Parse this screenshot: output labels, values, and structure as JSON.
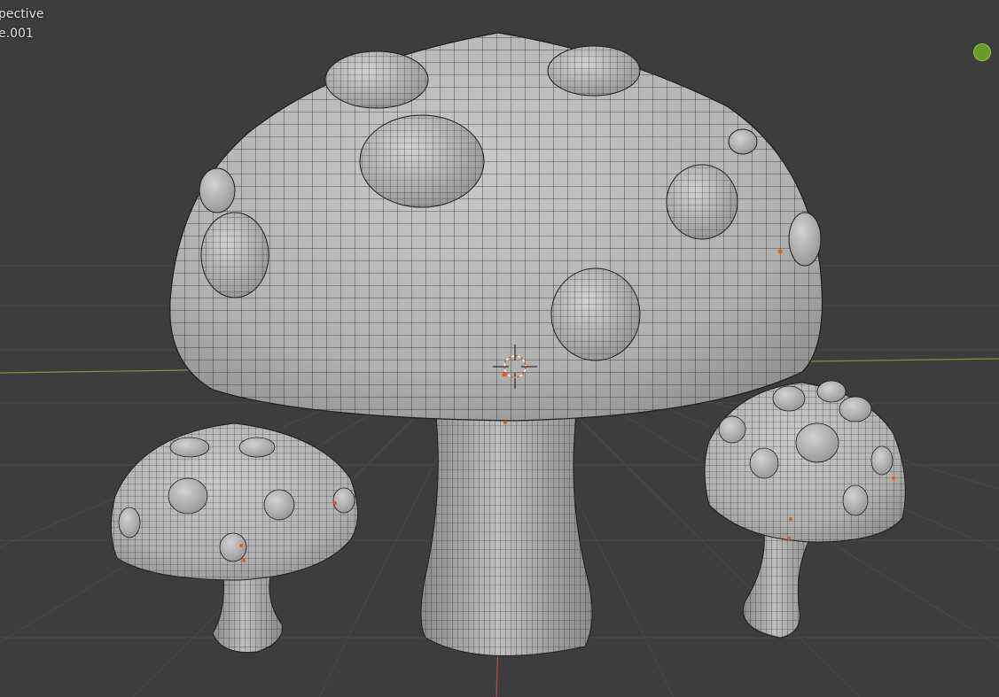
{
  "overlay": {
    "view_mode": "pective",
    "object_name": "e.001"
  },
  "colors": {
    "background": "#3d3d3d",
    "grid": "#494949",
    "x_axis": "#b44a4a",
    "y_axis": "#7a9a3a",
    "mesh_fill": "#b4b4b4",
    "mesh_shade": "#8a8a8a",
    "wire": "#2a2a2a",
    "origin": "#e05a1a",
    "gizmo": "#6a9a2a"
  },
  "icons": {
    "cursor": "3d-cursor-icon",
    "gizmo": "navigation-gizmo-icon"
  }
}
